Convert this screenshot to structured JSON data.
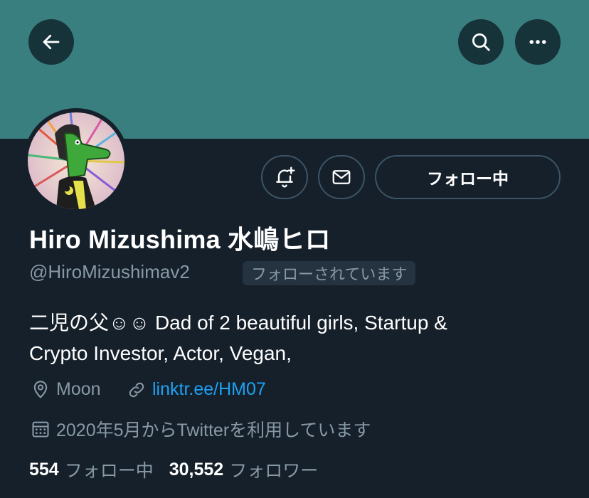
{
  "header": {
    "back_icon": "arrow-left-icon",
    "search_icon": "search-icon",
    "more_icon": "more-horizontal-icon"
  },
  "actions": {
    "notify_icon": "bell-plus-icon",
    "message_icon": "mail-icon",
    "follow_label": "フォロー中"
  },
  "profile": {
    "display_name": "Hiro Mizushima 水嶋ヒロ",
    "handle": "@HiroMizushimav2",
    "follows_you": "フォローされています",
    "bio_line1": "二児の父☺☺ Dad of 2 beautiful girls, Startup &",
    "bio_line2": "Crypto Investor, Actor, Vegan,",
    "location": "Moon",
    "link": "linktr.ee/HM07",
    "joined": "2020年5月からTwitterを利用しています"
  },
  "stats": {
    "following_count": "554",
    "following_label": "フォロー中",
    "followers_count": "30,552",
    "followers_label": "フォロワー"
  },
  "colors": {
    "background": "#15202b",
    "banner": "#3a7f80",
    "accent": "#1da1f2",
    "muted": "#8899a6"
  }
}
